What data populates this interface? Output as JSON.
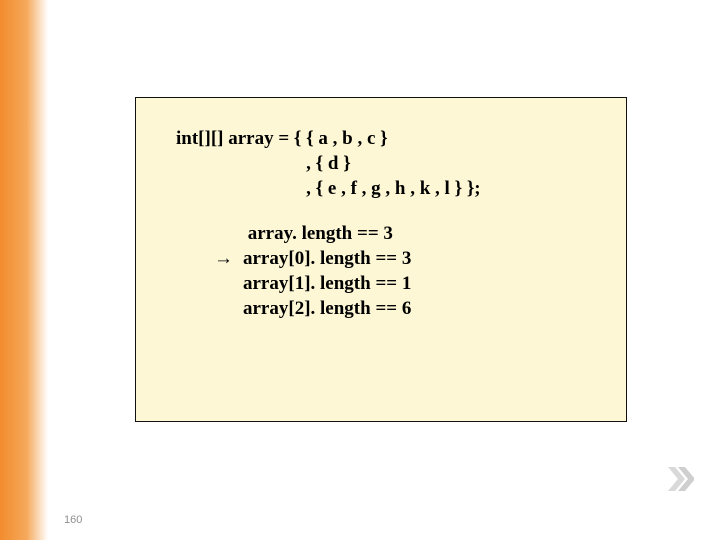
{
  "code": {
    "decl_lead": "int[][] array = { ",
    "decl_lines": [
      "{ a , b , c }",
      ", { d }",
      ", { e , f , g , h , k , l } };"
    ]
  },
  "arrow": "→",
  "results": [
    " array. length == 3",
    "array[0]. length == 3",
    "array[1]. length == 1",
    "array[2]. length == 6"
  ],
  "page_number": "160"
}
